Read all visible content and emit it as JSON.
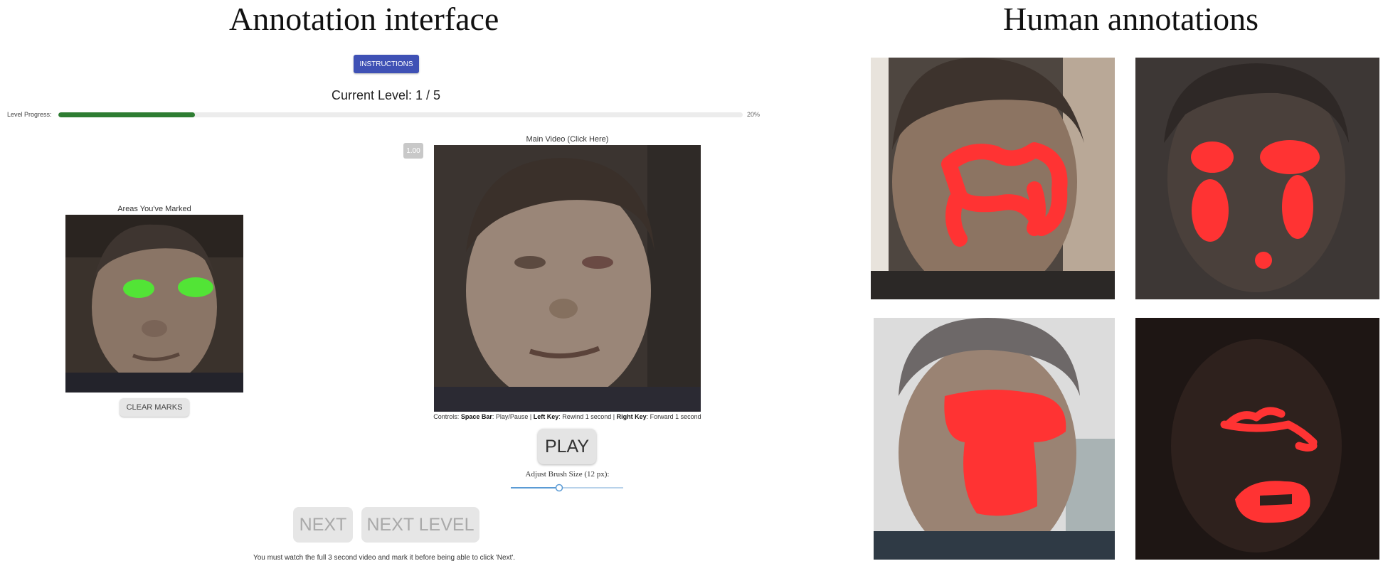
{
  "titles": {
    "left": "Annotation interface",
    "right": "Human annotations"
  },
  "interface": {
    "instructions_button": "INSTRUCTIONS",
    "current_level": "Current Level: 1 / 5",
    "level_progress_label": "Level Progress:",
    "level_progress_value": 0.2,
    "level_progress_text": "20%",
    "areas_marked_label": "Areas You've Marked",
    "clear_marks_button": "CLEAR MARKS",
    "speed_badge": "1.00",
    "main_video_label": "Main Video (Click Here)",
    "controls": {
      "prefix": "Controls:",
      "space_key": "Space Bar",
      "space_action": ": Play/Pause | ",
      "left_key": "Left Key",
      "left_action": ": Rewind 1 second | ",
      "right_key": "Right Key",
      "right_action": ": Forward 1 second"
    },
    "play_button": "PLAY",
    "brush_size_label": "Adjust Brush Size (12 px):",
    "brush_size_value": 12,
    "next_button": "NEXT",
    "next_level_button": "NEXT LEVEL",
    "footer_note": "You must watch the full 3 second video and mark it before being able to click 'Next'."
  },
  "colors": {
    "instructions_button": "#3f51b5",
    "progress_fill": "#2e7d32",
    "marked_areas": "#52e436",
    "human_annotation": "#ff3333"
  }
}
